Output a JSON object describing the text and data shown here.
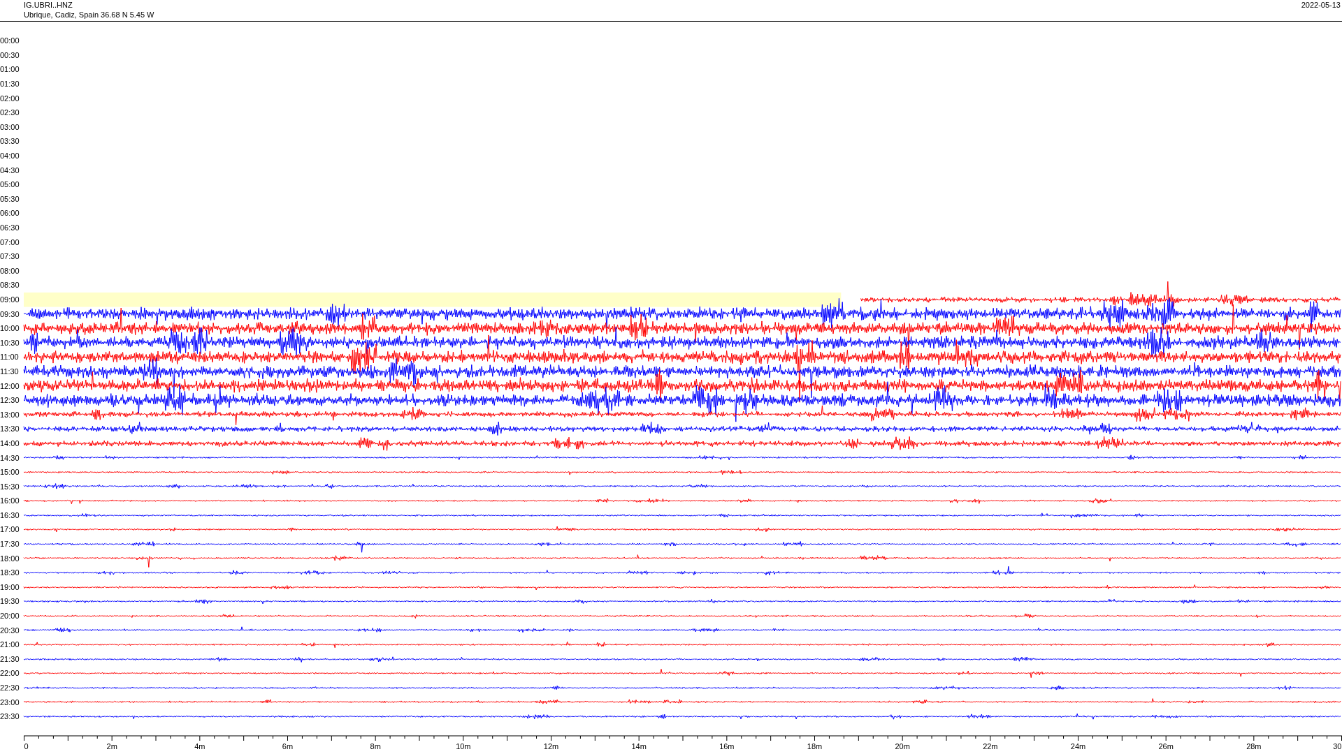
{
  "header": {
    "station": "IG.UBRI..HNZ",
    "location": "Ubrique, Cadiz, Spain  36.68 N 5.45 W",
    "date": "2022-05-13"
  },
  "rows": [
    {
      "time": "00:00",
      "kind": "empty"
    },
    {
      "time": "00:30",
      "kind": "empty"
    },
    {
      "time": "01:00",
      "kind": "empty"
    },
    {
      "time": "01:30",
      "kind": "empty"
    },
    {
      "time": "02:00",
      "kind": "empty"
    },
    {
      "time": "02:30",
      "kind": "empty"
    },
    {
      "time": "03:00",
      "kind": "empty"
    },
    {
      "time": "03:30",
      "kind": "empty"
    },
    {
      "time": "04:00",
      "kind": "empty"
    },
    {
      "time": "04:30",
      "kind": "empty"
    },
    {
      "time": "05:00",
      "kind": "empty"
    },
    {
      "time": "05:30",
      "kind": "empty"
    },
    {
      "time": "06:00",
      "kind": "empty"
    },
    {
      "time": "06:30",
      "kind": "empty"
    },
    {
      "time": "07:00",
      "kind": "empty"
    },
    {
      "time": "07:30",
      "kind": "empty"
    },
    {
      "time": "08:00",
      "kind": "empty"
    },
    {
      "time": "08:30",
      "kind": "empty"
    },
    {
      "time": "09:00",
      "kind": "partial",
      "color": "#ff0000"
    },
    {
      "time": "09:30",
      "kind": "loud",
      "color": "#0000ff"
    },
    {
      "time": "10:00",
      "kind": "loud",
      "color": "#ff0000"
    },
    {
      "time": "10:30",
      "kind": "loud",
      "color": "#0000ff"
    },
    {
      "time": "11:00",
      "kind": "loud",
      "color": "#ff0000"
    },
    {
      "time": "11:30",
      "kind": "loud",
      "color": "#0000ff"
    },
    {
      "time": "12:00",
      "kind": "loud",
      "color": "#ff0000"
    },
    {
      "time": "12:30",
      "kind": "loud",
      "color": "#0000ff"
    },
    {
      "time": "13:00",
      "kind": "moderate",
      "color": "#ff0000"
    },
    {
      "time": "13:30",
      "kind": "moderate",
      "color": "#0000ff"
    },
    {
      "time": "14:00",
      "kind": "moderate",
      "color": "#ff0000"
    },
    {
      "time": "14:30",
      "kind": "quiet",
      "color": "#0000ff"
    },
    {
      "time": "15:00",
      "kind": "quiet",
      "color": "#ff0000"
    },
    {
      "time": "15:30",
      "kind": "quiet",
      "color": "#0000ff"
    },
    {
      "time": "16:00",
      "kind": "quiet",
      "color": "#ff0000"
    },
    {
      "time": "16:30",
      "kind": "quiet",
      "color": "#0000ff"
    },
    {
      "time": "17:00",
      "kind": "quiet",
      "color": "#ff0000"
    },
    {
      "time": "17:30",
      "kind": "quiet",
      "color": "#0000ff"
    },
    {
      "time": "18:00",
      "kind": "quiet",
      "color": "#ff0000"
    },
    {
      "time": "18:30",
      "kind": "quiet",
      "color": "#0000ff"
    },
    {
      "time": "19:00",
      "kind": "quiet",
      "color": "#ff0000"
    },
    {
      "time": "19:30",
      "kind": "quiet",
      "color": "#0000ff"
    },
    {
      "time": "20:00",
      "kind": "quiet",
      "color": "#ff0000"
    },
    {
      "time": "20:30",
      "kind": "quiet",
      "color": "#0000ff"
    },
    {
      "time": "21:00",
      "kind": "quiet",
      "color": "#ff0000"
    },
    {
      "time": "21:30",
      "kind": "quiet",
      "color": "#0000ff"
    },
    {
      "time": "22:00",
      "kind": "quiet",
      "color": "#ff0000"
    },
    {
      "time": "22:30",
      "kind": "quiet",
      "color": "#0000ff"
    },
    {
      "time": "23:00",
      "kind": "quiet",
      "color": "#ff0000"
    },
    {
      "time": "23:30",
      "kind": "quiet",
      "color": "#0000ff"
    }
  ],
  "axis": {
    "labels": [
      "0",
      "2m",
      "4m",
      "6m",
      "8m",
      "10m",
      "12m",
      "14m",
      "16m",
      "18m",
      "20m",
      "22m",
      "24m",
      "26m",
      "28m",
      "30"
    ]
  }
}
